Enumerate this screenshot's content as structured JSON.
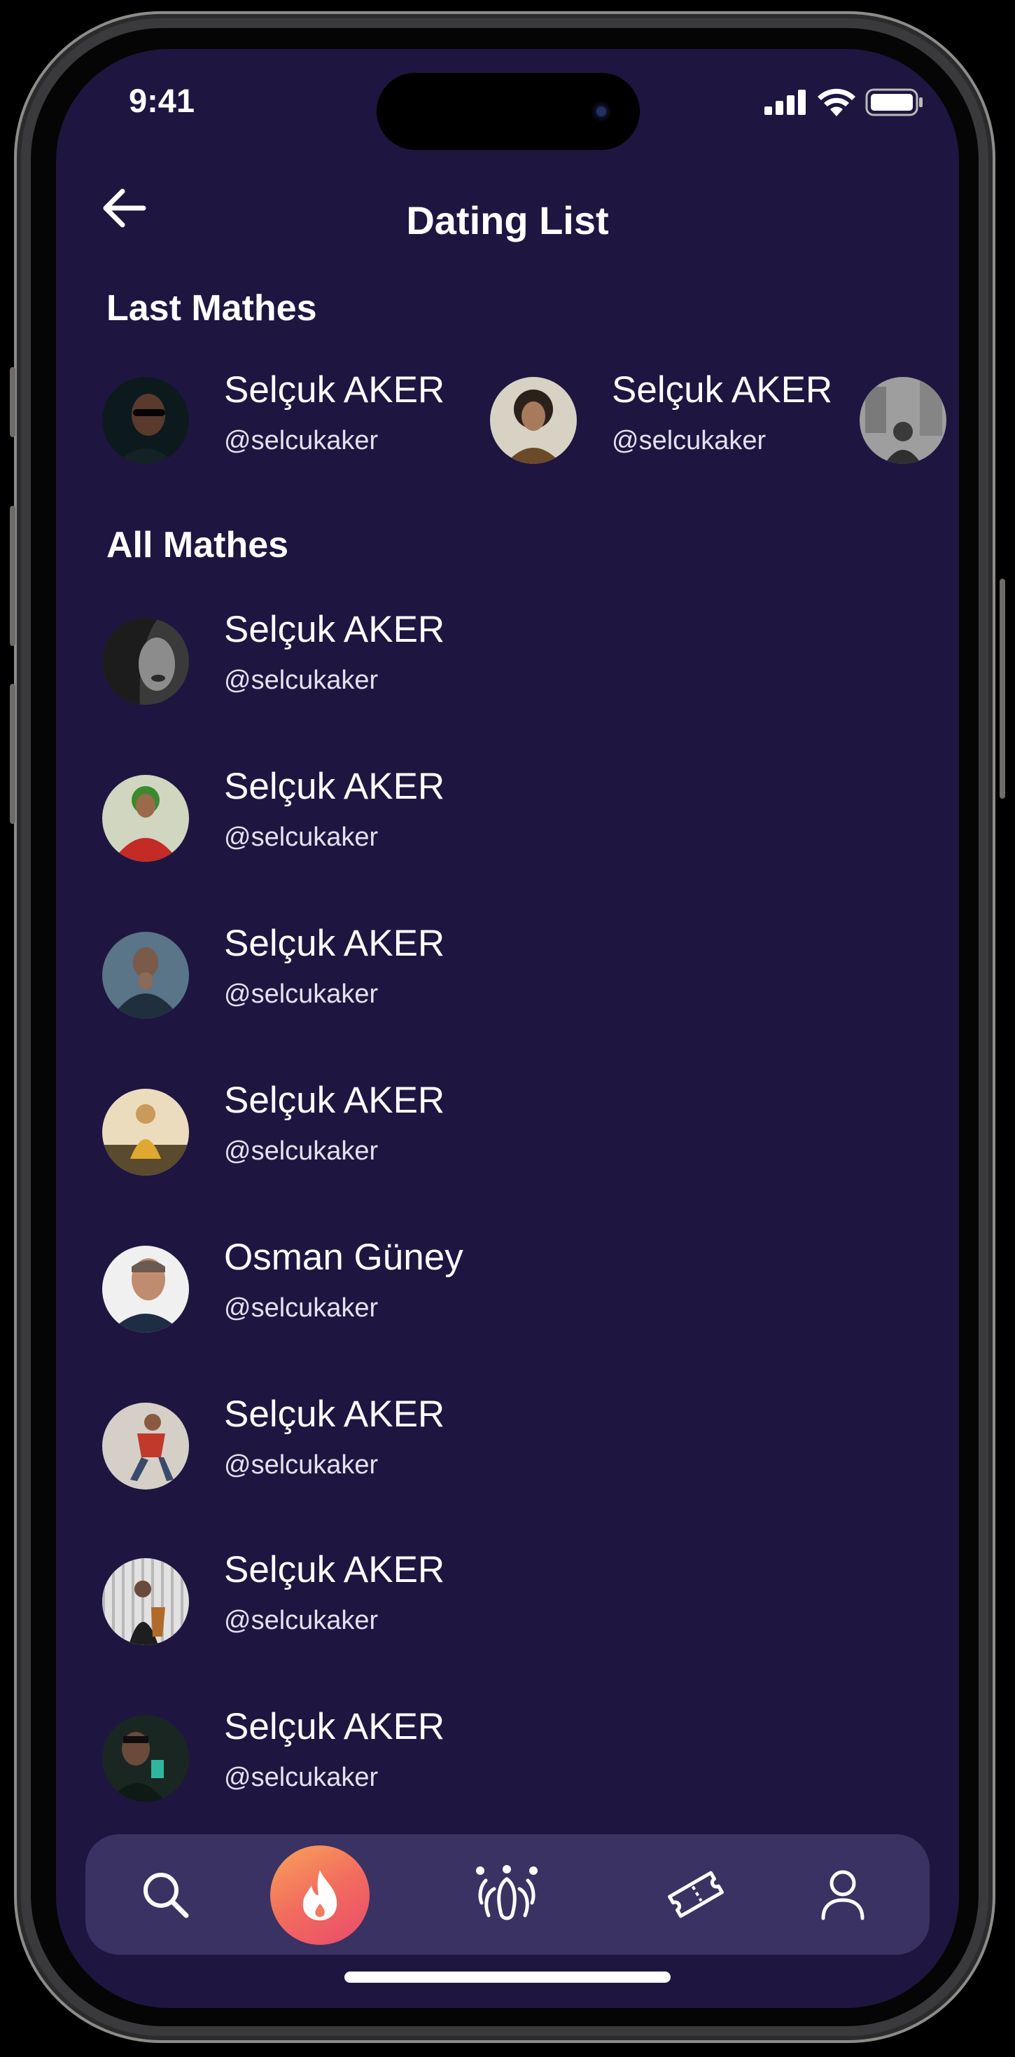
{
  "status_bar": {
    "time": "9:41"
  },
  "header": {
    "title": "Dating List"
  },
  "last_matches": {
    "title": "Last Mathes",
    "items": [
      {
        "name": "Selçuk AKER",
        "handle": "@selcukaker"
      },
      {
        "name": "Selçuk AKER",
        "handle": "@selcukaker"
      }
    ]
  },
  "all_matches": {
    "title": "All Mathes",
    "items": [
      {
        "name": "Selçuk AKER",
        "handle": "@selcukaker"
      },
      {
        "name": "Selçuk AKER",
        "handle": "@selcukaker"
      },
      {
        "name": "Selçuk AKER",
        "handle": "@selcukaker"
      },
      {
        "name": "Selçuk AKER",
        "handle": "@selcukaker"
      },
      {
        "name": "Osman Güney",
        "handle": "@selcukaker"
      },
      {
        "name": "Selçuk AKER",
        "handle": "@selcukaker"
      },
      {
        "name": "Selçuk AKER",
        "handle": "@selcukaker"
      },
      {
        "name": "Selçuk AKER",
        "handle": "@selcukaker"
      }
    ]
  },
  "nav": {
    "items": [
      {
        "icon": "search-icon"
      },
      {
        "icon": "flame-icon",
        "active": true
      },
      {
        "icon": "matches-icon"
      },
      {
        "icon": "ticket-icon"
      },
      {
        "icon": "profile-icon"
      }
    ]
  },
  "colors": {
    "background": "#1e1640",
    "nav_background": "#3a3262",
    "accent_start": "#f8a35a",
    "accent_end": "#e94a6c",
    "text": "#ffffff"
  }
}
